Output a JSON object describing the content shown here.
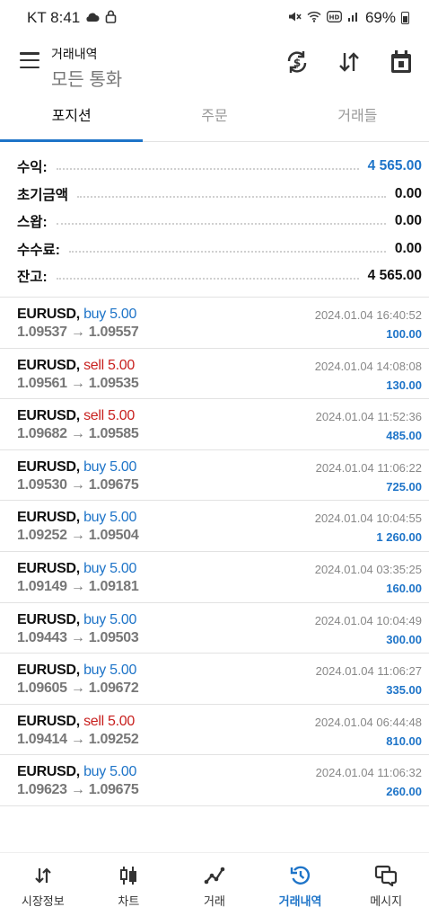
{
  "status_bar": {
    "carrier_time": "KT 8:41",
    "battery": "69%",
    "icons": [
      "cloud-icon",
      "lock-icon",
      "mute-icon",
      "wifi-icon",
      "hd-icon",
      "signal-icon",
      "battery-icon"
    ]
  },
  "header": {
    "title": "거래내역",
    "subtitle": "모든 통화",
    "actions": [
      "currency-exchange-icon",
      "sort-icon",
      "calendar-icon"
    ]
  },
  "tabs": [
    {
      "label": "포지션",
      "active": true
    },
    {
      "label": "주문",
      "active": false
    },
    {
      "label": "거래들",
      "active": false
    }
  ],
  "summary": [
    {
      "label": "수익:",
      "value": "4 565.00",
      "color": "#1e74c8"
    },
    {
      "label": "초기금액",
      "value": "0.00"
    },
    {
      "label": "스왑:",
      "value": "0.00"
    },
    {
      "label": "수수료:",
      "value": "0.00"
    },
    {
      "label": "잔고:",
      "value": "4 565.00"
    }
  ],
  "deals": [
    {
      "symbol": "EURUSD,",
      "side": "buy",
      "side_label": "buy 5.00",
      "prices": "1.09537 → 1.09557",
      "time": "2024.01.04 16:40:52",
      "profit": "100.00"
    },
    {
      "symbol": "EURUSD,",
      "side": "sell",
      "side_label": "sell 5.00",
      "prices": "1.09561 → 1.09535",
      "time": "2024.01.04 14:08:08",
      "profit": "130.00"
    },
    {
      "symbol": "EURUSD,",
      "side": "sell",
      "side_label": "sell 5.00",
      "prices": "1.09682 → 1.09585",
      "time": "2024.01.04 11:52:36",
      "profit": "485.00"
    },
    {
      "symbol": "EURUSD,",
      "side": "buy",
      "side_label": "buy 5.00",
      "prices": "1.09530 → 1.09675",
      "time": "2024.01.04 11:06:22",
      "profit": "725.00"
    },
    {
      "symbol": "EURUSD,",
      "side": "buy",
      "side_label": "buy 5.00",
      "prices": "1.09252 → 1.09504",
      "time": "2024.01.04 10:04:55",
      "profit": "1 260.00"
    },
    {
      "symbol": "EURUSD,",
      "side": "buy",
      "side_label": "buy 5.00",
      "prices": "1.09149 → 1.09181",
      "time": "2024.01.04 03:35:25",
      "profit": "160.00"
    },
    {
      "symbol": "EURUSD,",
      "side": "buy",
      "side_label": "buy 5.00",
      "prices": "1.09443 → 1.09503",
      "time": "2024.01.04 10:04:49",
      "profit": "300.00"
    },
    {
      "symbol": "EURUSD,",
      "side": "buy",
      "side_label": "buy 5.00",
      "prices": "1.09605 → 1.09672",
      "time": "2024.01.04 11:06:27",
      "profit": "335.00"
    },
    {
      "symbol": "EURUSD,",
      "side": "sell",
      "side_label": "sell 5.00",
      "prices": "1.09414 → 1.09252",
      "time": "2024.01.04 06:44:48",
      "profit": "810.00"
    },
    {
      "symbol": "EURUSD,",
      "side": "buy",
      "side_label": "buy 5.00",
      "prices": "1.09623 → 1.09675",
      "time": "2024.01.04 11:06:32",
      "profit": "260.00"
    }
  ],
  "bottom_nav": [
    {
      "label": "시장정보",
      "icon": "quotes-icon",
      "active": false
    },
    {
      "label": "차트",
      "icon": "chart-icon",
      "active": false
    },
    {
      "label": "거래",
      "icon": "trade-icon",
      "active": false
    },
    {
      "label": "거래내역",
      "icon": "history-icon",
      "active": true
    },
    {
      "label": "메시지",
      "icon": "messages-icon",
      "active": false
    }
  ],
  "colors": {
    "accent": "#1e74c8",
    "sell": "#c8201e"
  }
}
